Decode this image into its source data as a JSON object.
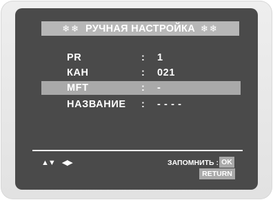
{
  "menu": {
    "title": "РУЧНАЯ НАСТРОЙКА",
    "title_ornament_icon": "snowflake-ornament-icon",
    "rows": [
      {
        "label": "PR",
        "separator": ":",
        "value": "1"
      },
      {
        "label": "КАН",
        "separator": ":",
        "value": "021"
      },
      {
        "label": "MFT",
        "separator": ":",
        "value": "-"
      },
      {
        "label": "НАЗВАНИЕ",
        "separator": ":",
        "value": "- - - -"
      }
    ],
    "selected_row": "MFT"
  },
  "footer": {
    "nav_up_down": "▲▼",
    "nav_left_right": "◀▶",
    "save_label": "ЗАПОМНИТЬ :",
    "ok_key": "OK",
    "return_key": "RETURN"
  },
  "colors": {
    "screen_bg": "#4a4a4a",
    "highlight": "#a9a9a9",
    "title_bar": "#b7b7b7",
    "text": "#ffffff"
  }
}
